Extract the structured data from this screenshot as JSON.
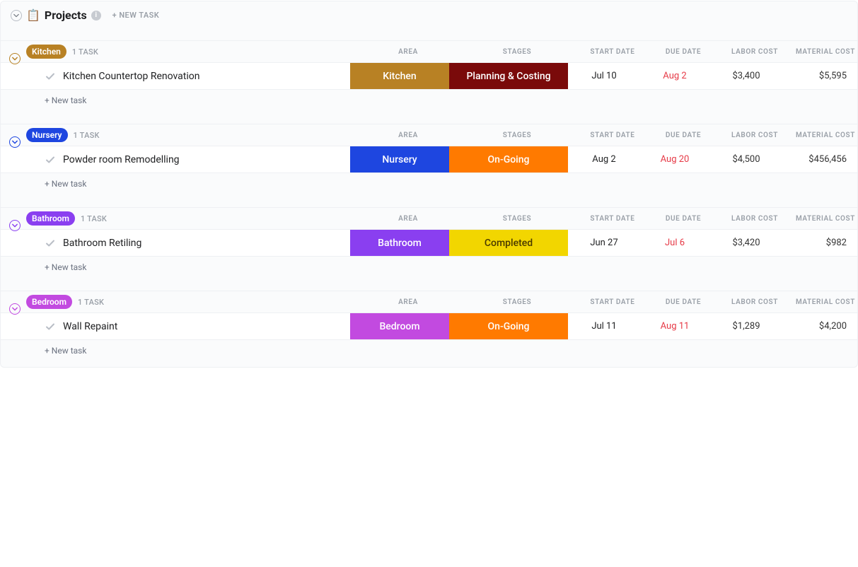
{
  "header": {
    "title": "Projects",
    "emoji": "📋",
    "info_glyph": "i",
    "new_task_top": "+ NEW TASK"
  },
  "columns": {
    "area": "AREA",
    "stages": "STAGES",
    "start_date": "START DATE",
    "due_date": "DUE DATE",
    "labor_cost": "LABOR COST",
    "material_cost": "MATERIAL COST"
  },
  "labels": {
    "new_task": "+ New task",
    "task_count_suffix": "1 TASK"
  },
  "colors": {
    "kitchen_pill": "#b88124",
    "nursery_pill": "#1e46e0",
    "bathroom_pill": "#8a3ff0",
    "bedroom_pill": "#c24ae0",
    "area_kitchen": "#b88124",
    "area_nursery": "#1e46e0",
    "area_bathroom": "#8a3ff0",
    "area_bedroom": "#c24ae0",
    "stage_planning": "#7a0a0a",
    "stage_ongoing": "#ff7a00",
    "stage_completed": "#f2d600"
  },
  "groups": [
    {
      "label": "Kitchen",
      "accent": "#b88124",
      "task": {
        "name": "Kitchen Countertop Renovation",
        "area_label": "Kitchen",
        "area_color": "#b88124",
        "stage_label": "Planning & Costing",
        "stage_color": "#7a0a0a",
        "start": "Jul 10",
        "due": "Aug 2",
        "labor": "$3,400",
        "material": "$5,595"
      }
    },
    {
      "label": "Nursery",
      "accent": "#1e46e0",
      "task": {
        "name": "Powder room Remodelling",
        "area_label": "Nursery",
        "area_color": "#1e46e0",
        "stage_label": "On-Going",
        "stage_color": "#ff7a00",
        "start": "Aug 2",
        "due": "Aug 20",
        "labor": "$4,500",
        "material": "$456,456"
      }
    },
    {
      "label": "Bathroom",
      "accent": "#8a3ff0",
      "task": {
        "name": "Bathroom Retiling",
        "area_label": "Bathroom",
        "area_color": "#8a3ff0",
        "stage_label": "Completed",
        "stage_color": "#f2d600",
        "stage_text_color": "#4a3a00",
        "start": "Jun 27",
        "due": "Jul 6",
        "labor": "$3,420",
        "material": "$982"
      }
    },
    {
      "label": "Bedroom",
      "accent": "#c24ae0",
      "task": {
        "name": "Wall Repaint",
        "area_label": "Bedroom",
        "area_color": "#c24ae0",
        "stage_label": "On-Going",
        "stage_color": "#ff7a00",
        "start": "Jul 11",
        "due": "Aug 11",
        "labor": "$1,289",
        "material": "$4,200"
      }
    }
  ]
}
